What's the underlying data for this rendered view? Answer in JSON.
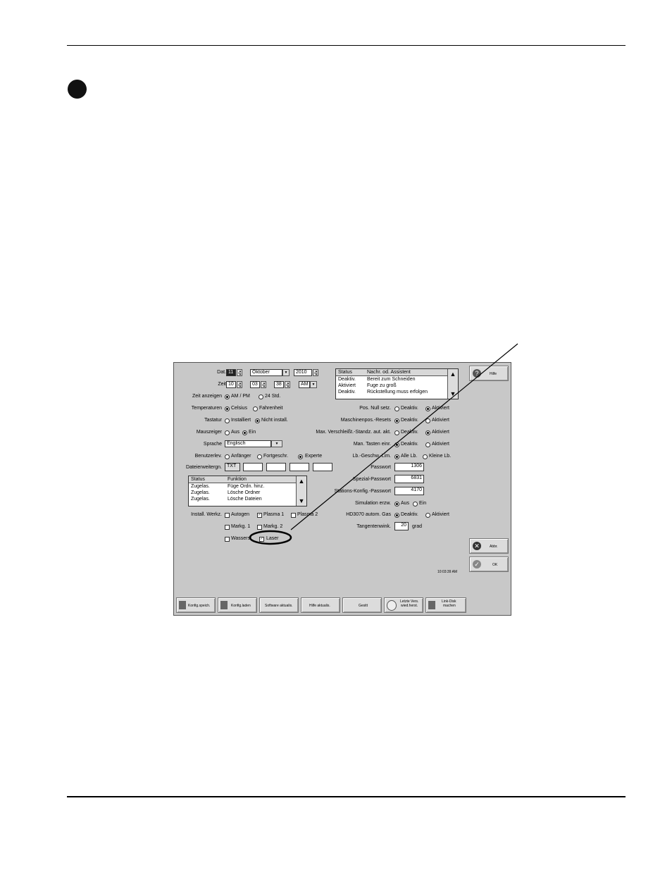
{
  "left": {
    "dat_label": "Dat.",
    "dat_day": "11",
    "dat_month": "Oktober",
    "dat_year": "2010",
    "zeit_label": "Zeit",
    "zeit_h": "10",
    "zeit_m": "03",
    "zeit_s": "38",
    "zeit_ampm": "AM",
    "zeit_anzeigen_label": "Zeit anzeigen",
    "zeit_opt1": "AM / PM",
    "zeit_opt2": "24 Std.",
    "temp_label": "Temperaturen",
    "temp_opt1": "Celsius",
    "temp_opt2": "Fahrenheit",
    "tast_label": "Tastatur",
    "tast_opt1": "Installiert",
    "tast_opt2": "Nicht install.",
    "maus_label": "Mauszeiger",
    "maus_opt1": "Aus",
    "maus_opt2": "Ein",
    "sprache_label": "Sprache",
    "sprache_value": "Englisch",
    "benutzer_label": "Benutzerlev.",
    "benutzer_opt1": "Anfänger",
    "benutzer_opt2": "Fortgeschr.",
    "benutzer_opt3": "Experte",
    "datei_label": "Dateierweitergn.",
    "datei_ext1": "TXT",
    "list_headers": [
      "Status",
      "Funktion"
    ],
    "list_rows": [
      [
        "Zugelas.",
        "Füge Ordn. hinz."
      ],
      [
        "Zugelas.",
        "Lösche Ordner"
      ],
      [
        "Zugelas.",
        "Lösche Dateien"
      ]
    ],
    "werkz_label": "Install. Werkz.",
    "werkz_autogen": "Autogen",
    "werkz_plasma1": "Plasma 1",
    "werkz_plasma2": "Plasma 2",
    "werkz_markg1": "Markg. 1",
    "werkz_markg2": "Markg. 2",
    "werkz_wasser": "Wasserst",
    "werkz_laser": "Laser",
    "check_mark": "✓"
  },
  "right": {
    "status_headers": [
      "Status",
      "Nachr. od. Assistent"
    ],
    "status_rows": [
      [
        "Deaktiv.",
        "Bereit zum Schneiden"
      ],
      [
        "Aktiviert",
        "Fuge zu groß"
      ],
      [
        "Deaktiv.",
        "Rückstellung muss erfolgen"
      ]
    ],
    "deaktiv": "Deaktiv.",
    "aktiviert": "Aktiviert",
    "pos_label": "Pos. Null setz.",
    "masch_label": "Maschinenpos.-Resets",
    "max_label": "Max. Verschleißt.-Standz. aut. akt.",
    "man_label": "Man. Tasten einr.",
    "lb_label": "Lb.-Geschw.-Lim.",
    "lb_opt1": "Alle Lb.",
    "lb_opt2": "Kleine Lb.",
    "passwort_label": "Passwort",
    "passwort_value": "1306",
    "spezial_label": "Spezial-Passwort",
    "spezial_value": "6831",
    "stations_label": "Stations-Konfig.-Passwort",
    "stations_value": "4170",
    "sim_label": "Simulation erzw.",
    "sim_opt1": "Aus",
    "sim_opt2": "Ein",
    "hd_label": "HD3070 autom. Gas",
    "tang_label": "Tangentenwink.",
    "tang_value": "20",
    "tang_unit": "grad"
  },
  "side": {
    "hilfe": "Hilfe",
    "abbr": "Abbr.",
    "ok": "OK",
    "time": "10:03:39 AM"
  },
  "toolbar": {
    "konfig_speich": "Konfig.speich.",
    "konfig_laden": "Konfig.laden",
    "software": "Software aktualis.",
    "hilfe_akt": "Hilfe aktualis.",
    "gesitt": "Gesitt",
    "letzte_1": "Letzte Vers.",
    "letzte_2": "wied.herst.",
    "linkdisk_1": "Link-Disk",
    "linkdisk_2": "machen"
  }
}
